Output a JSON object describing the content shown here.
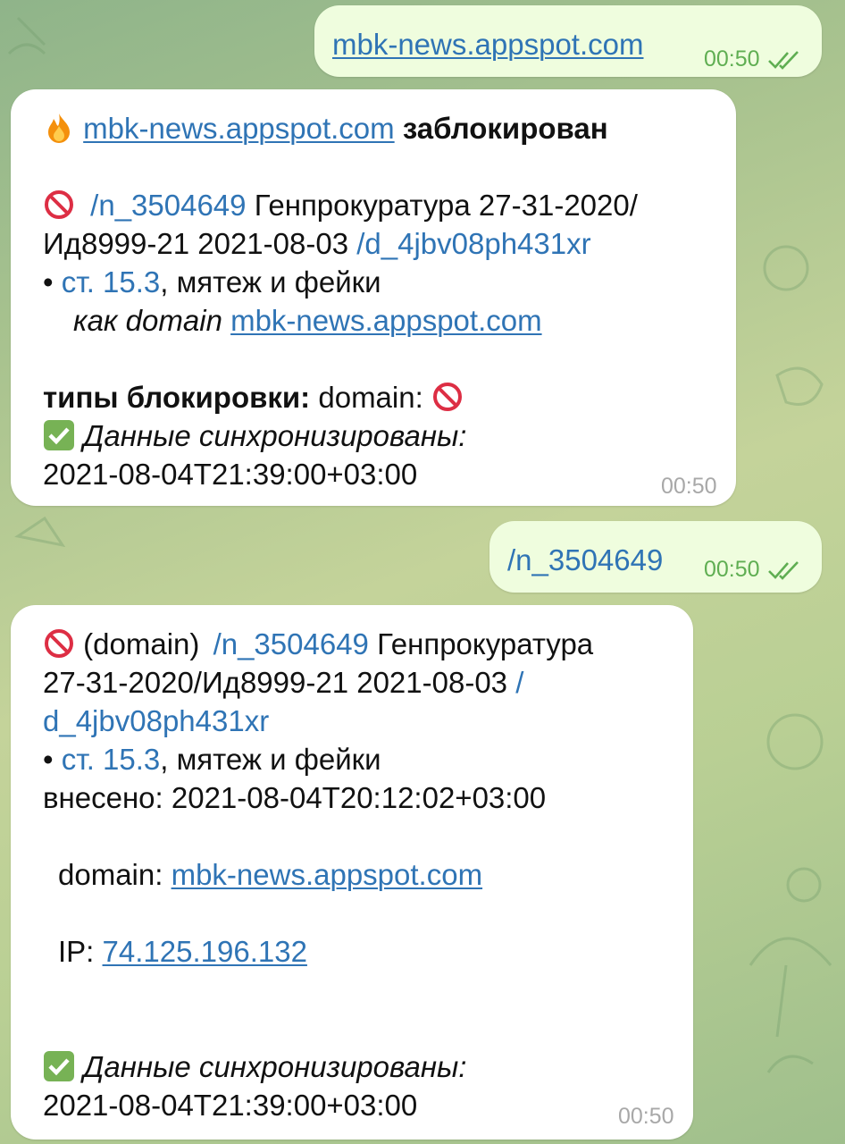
{
  "colors": {
    "link": "#2f74b5",
    "incoming_bubble": "#ffffff",
    "outgoing_bubble": "#effdde",
    "read_checks": "#5fae52",
    "time_gray": "#a8a8a8"
  },
  "messages": [
    {
      "kind": "outgoing",
      "text": "mbk-news.appspot.com",
      "time": "00:50"
    },
    {
      "kind": "incoming",
      "title_domain": "mbk-news.appspot.com",
      "title_status": "заблокирован",
      "entry_cmd": "/n_3504649",
      "entry_text1": "Генпрокуратура 27-31-2020/",
      "entry_text2": "Ид8999-21 2021-08-03",
      "entry_doc": "/d_4jbv08ph431xr",
      "bullet": "•",
      "article_link": "ст. 15.3",
      "article_rest": ", мятеж и фейки",
      "as_label": "как domain",
      "as_domain": "mbk-news.appspot.com",
      "types_label": "типы блокировки:",
      "types_value": "domain:",
      "sync_label": "Данные синхронизированы:",
      "sync_time": "2021-08-04T21:39:00+03:00",
      "time": "00:50"
    },
    {
      "kind": "outgoing",
      "text": "/n_3504649",
      "time": "00:50"
    },
    {
      "kind": "incoming",
      "type_label": "(domain)",
      "entry_cmd": "/n_3504649",
      "entry_text1": "Генпрокуратура",
      "entry_text2": "27-31-2020/Ид8999-21 2021-08-03",
      "entry_doc_a": "/",
      "entry_doc_b": "d_4jbv08ph431xr",
      "bullet": "•",
      "article_link": "ст. 15.3",
      "article_rest": ", мятеж и фейки",
      "added_label": "внесено: 2021-08-04T20:12:02+03:00",
      "domain_label": "domain:",
      "domain_value": "mbk-news.appspot.com",
      "ip_label": "IP:",
      "ip_value": "74.125.196.132",
      "sync_label": "Данные синхронизированы:",
      "sync_time": "2021-08-04T21:39:00+03:00",
      "time": "00:50"
    }
  ],
  "icons": [
    "fire-icon",
    "no-entry-icon",
    "check-mark-icon",
    "double-check-icon"
  ]
}
